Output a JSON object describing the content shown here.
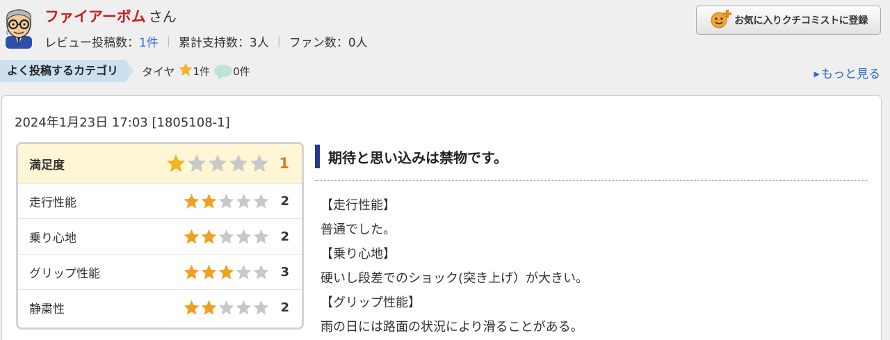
{
  "user": {
    "name": "ファイアーボム",
    "suffix": "さん",
    "review_count_label": "レビュー投稿数：",
    "review_count": "1件",
    "support_label": "累計支持数：",
    "support_count": "3人",
    "fan_label": "ファン数：",
    "fan_count": "0人"
  },
  "favorite_button": {
    "label": "お気に入りクチコミストに登録",
    "icon": "smiley-plus-icon"
  },
  "categories": {
    "tag": "よく投稿するカテゴリ",
    "items": [
      {
        "name": "タイヤ",
        "star_count": "1件",
        "comment_count": "0件"
      }
    ],
    "more_link": "もっと見る"
  },
  "review": {
    "date": "2024年1月23日 17:03 [1805108-1]",
    "title": "期待と思い込みは禁物です。",
    "ratings": [
      {
        "label": "満足度",
        "score": 1,
        "score_text": "1"
      },
      {
        "label": "走行性能",
        "score": 2,
        "score_text": "2"
      },
      {
        "label": "乗り心地",
        "score": 2,
        "score_text": "2"
      },
      {
        "label": "グリップ性能",
        "score": 3,
        "score_text": "3"
      },
      {
        "label": "静粛性",
        "score": 2,
        "score_text": "2"
      }
    ],
    "body": [
      "【走行性能】",
      "普通でした。",
      "【乗り心地】",
      "硬いし段差でのショック(突き上げ）が大きい。",
      "【グリップ性能】",
      "雨の日には路面の状況により滑ることがある。"
    ]
  },
  "colors": {
    "user_name": "#c81e1e",
    "link": "#2a6bd0",
    "star_orange": "#f0a020",
    "star_gray": "#c8c8c8",
    "title_bar": "#1f3a8f",
    "highlight_row": "#fff6d6",
    "category_tag": "#cde0f0"
  }
}
